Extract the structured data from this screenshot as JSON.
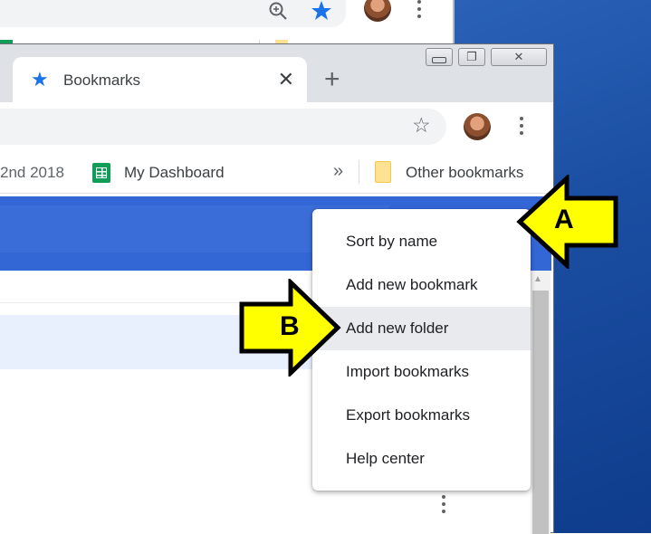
{
  "back_window": {
    "icons": [
      "zoom-icon",
      "star-icon",
      "avatar",
      "more-icon"
    ]
  },
  "tab": {
    "title": "Bookmarks",
    "close": "✕",
    "new_tab": "+"
  },
  "window_controls": {
    "minimize": "—",
    "restore": "❐",
    "close": "✕"
  },
  "bookmarks_bar": {
    "partial_item": "2nd 2018",
    "dashboard": "My Dashboard",
    "overflow": "»",
    "other": "Other bookmarks"
  },
  "menu": {
    "items": [
      {
        "label": "Sort by name"
      },
      {
        "label": "Add new bookmark"
      },
      {
        "label": "Add new folder",
        "highlighted": true
      },
      {
        "label": "Import bookmarks"
      },
      {
        "label": "Export bookmarks"
      },
      {
        "label": "Help center"
      }
    ]
  },
  "annotations": {
    "arrow_a": "A",
    "arrow_b": "B"
  },
  "colors": {
    "accent": "#1a73e8",
    "header_band": "#3367d6",
    "arrow_fill": "#ffff00"
  }
}
